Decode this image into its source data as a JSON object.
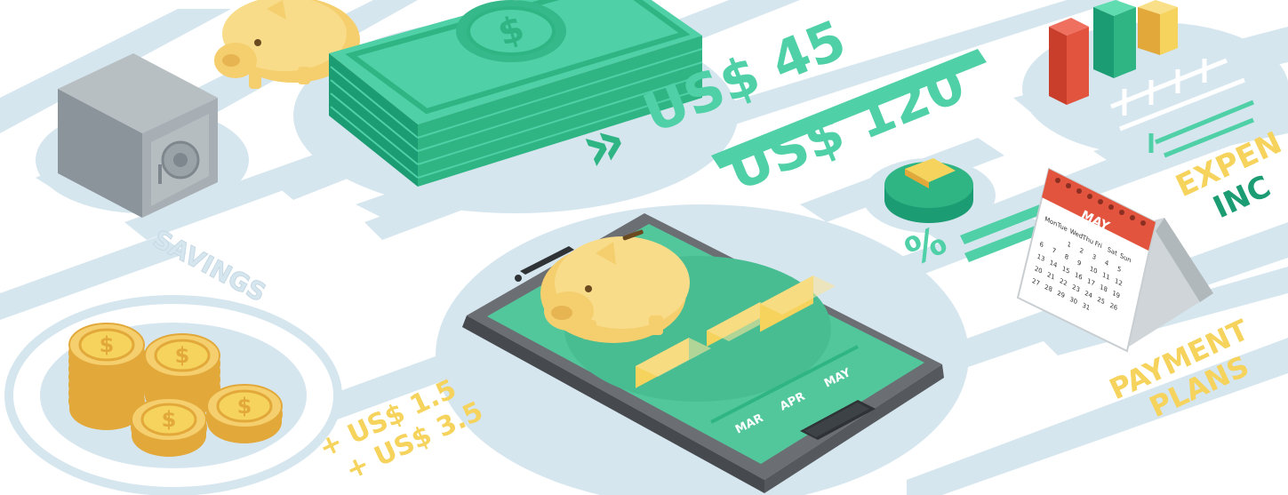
{
  "labels": {
    "savings": "SAVINGS",
    "amount_45": "US$ 45",
    "amount_120": "US$ 120",
    "percent": "%",
    "expenses": "EXPEN",
    "income": "INC",
    "payment_line1": "PAYMENT",
    "payment_line2": "PLANS",
    "coins_line1": "+ US$ 1.5",
    "coins_line2": "+ US$ 3.5",
    "chevrons": "»"
  },
  "calendar": {
    "month": "MAY",
    "weekdays": [
      "Mon",
      "Tue",
      "Wed",
      "Thu",
      "Fri",
      "Sat",
      "Sun"
    ],
    "rows": [
      [
        "",
        "",
        "1",
        "2",
        "3",
        "4",
        "5"
      ],
      [
        "6",
        "7",
        "8",
        "9",
        "10",
        "11",
        "12"
      ],
      [
        "13",
        "14",
        "15",
        "16",
        "17",
        "18",
        "19"
      ],
      [
        "20",
        "21",
        "22",
        "23",
        "24",
        "25",
        "26"
      ],
      [
        "27",
        "28",
        "29",
        "30",
        "31",
        "",
        ""
      ]
    ]
  },
  "phone_chart": {
    "categories": [
      "MAR",
      "APR",
      "MAY"
    ],
    "values": [
      2,
      1,
      3
    ]
  },
  "colors": {
    "path": "#d6e6ef",
    "mint": "#4fd0a6",
    "mint_dark": "#1c9c73",
    "gold": "#f5d35c",
    "gold_dark": "#e2a93a",
    "pig": "#f8dc8a",
    "safe": "#9aa3a8",
    "red": "#e2543d",
    "phone": "#5c5f63",
    "screen": "#53c79c"
  },
  "icons": {
    "safe": "safe-icon",
    "piggy": "piggy-bank-icon",
    "cash": "cash-stack-icon",
    "coins": "coin-stack-icon",
    "pie": "pie-chart-icon",
    "bars": "bar-chart-icon",
    "calendar": "calendar-icon",
    "phone": "smartphone-icon"
  }
}
